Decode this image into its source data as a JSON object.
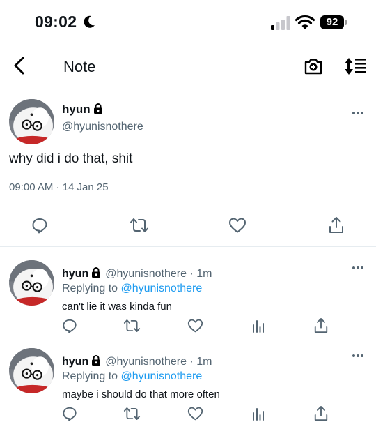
{
  "status_bar": {
    "time": "09:02",
    "battery": "92"
  },
  "nav": {
    "title": "Note"
  },
  "main_tweet": {
    "name": "hyun",
    "handle": "@hyunisnothere",
    "text": "why did i do that, shit",
    "timestamp": "09:00 AM · 14 Jan 25"
  },
  "replies": [
    {
      "name": "hyun",
      "handle_time": "@hyunisnothere · 1m",
      "replying_prefix": "Replying to",
      "replying_to": "@hyunisnothere",
      "text": "can't lie it was kinda fun"
    },
    {
      "name": "hyun",
      "handle_time": "@hyunisnothere · 1m",
      "replying_prefix": "Replying to",
      "replying_to": "@hyunisnothere",
      "text": "maybe i should do that more often"
    }
  ],
  "colors": {
    "link": "#1d9bf0",
    "secondary_text": "#536471",
    "icon": "#536471",
    "divider": "#e6ecf0"
  },
  "icons": [
    "moon-icon",
    "signal-icon",
    "wifi-icon",
    "back-icon",
    "camera-plus-icon",
    "sort-icon",
    "lock-icon",
    "more-icon",
    "reply-icon",
    "retweet-icon",
    "like-icon",
    "views-icon",
    "share-icon"
  ]
}
